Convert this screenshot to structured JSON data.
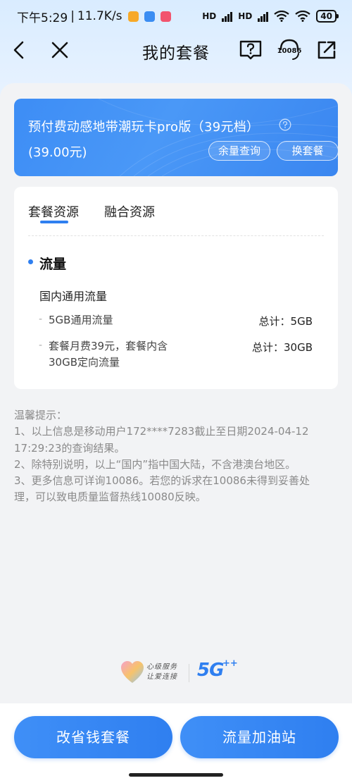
{
  "status_bar": {
    "time": "下午5:29",
    "separator": "|",
    "speed": "11.7K/s",
    "signal_label_1": "HD",
    "signal_label_2": "HD",
    "battery": "40"
  },
  "nav": {
    "title": "我的套餐",
    "hotline_icon_label": "10086"
  },
  "plan": {
    "name": "预付费动感地带潮玩卡pro版（39元档）",
    "price": "(39.00元)",
    "balance_button": "余量查询",
    "change_button": "换套餐"
  },
  "resources": {
    "tabs": [
      {
        "label": "套餐资源",
        "active": true
      },
      {
        "label": "融合资源",
        "active": false
      }
    ],
    "section_title": "流量",
    "group_title": "国内通用流量",
    "items": [
      {
        "dash": "-",
        "name": "5GB通用流量",
        "total": "总计：5GB"
      },
      {
        "dash": "-",
        "name_line1": "套餐月费39元，套餐内含",
        "name_line2": "30GB定向流量",
        "total": "总计：30GB"
      }
    ]
  },
  "tips": {
    "heading": "温馨提示：",
    "lines": [
      "1、以上信息是移动用户172****7283截止至日期2024-04-12",
      "17:29:23的查询结果。",
      "2、除特别说明，以上“国内”指中国大陆，不含港澳台地区。",
      "3、更多信息可详询10086。若您的诉求在10086未得到妥善处",
      "理，可以致电质量监督热线10080反映。"
    ]
  },
  "footer_logo": {
    "slogan_line1": "心级服务",
    "slogan_line2": "让爱连接",
    "brand": "5G",
    "plus": "++"
  },
  "buttons": {
    "save_plan": "改省钱套餐",
    "data_station": "流量加油站"
  },
  "colors": {
    "accent": "#2f7ff0",
    "card_blue": "#3d8df5",
    "background": "#f2f3f5"
  }
}
